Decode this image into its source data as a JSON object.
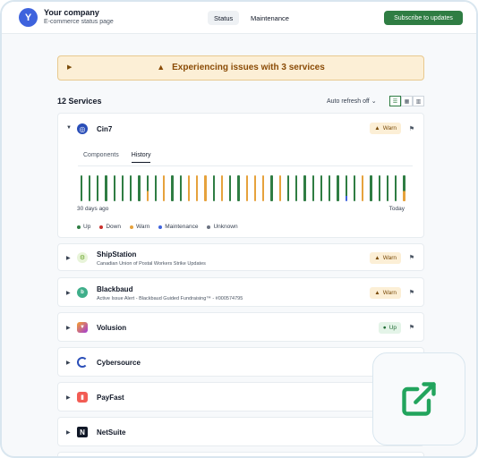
{
  "company": {
    "avatar": "Y",
    "name": "Your company",
    "subtitle": "E-commerce status page"
  },
  "nav": {
    "status": "Status",
    "maintenance": "Maintenance",
    "subscribe": "Subscribe to updates"
  },
  "alert": {
    "text": "Experiencing issues with 3 services"
  },
  "services_header": {
    "count": "12 Services",
    "auto_refresh": "Auto refresh off"
  },
  "services": [
    {
      "name": "Cin7",
      "status": "Warn",
      "expanded": true
    },
    {
      "name": "ShipStation",
      "description": "Canadian Union of Postal Workers Strike Updates",
      "status": "Warn"
    },
    {
      "name": "Blackbaud",
      "description": "Active Issue Alert - Blackbaud Guided Fundraising™ - #000574795",
      "status": "Warn"
    },
    {
      "name": "Volusion",
      "status": "Up"
    },
    {
      "name": "Cybersource"
    },
    {
      "name": "PayFast"
    },
    {
      "name": "NetSuite"
    }
  ],
  "detail": {
    "tabs": [
      "Components",
      "History"
    ],
    "active_tab": "History",
    "range_start": "30 days ago",
    "range_end": "Today",
    "history": [
      "up",
      "up",
      "up",
      "up",
      "up",
      "up",
      "up",
      "up",
      "warn",
      "up",
      "warn",
      "up",
      "up",
      "warn",
      "warn",
      "warn",
      "up",
      "warn",
      "up",
      "up",
      "warn",
      "warn",
      "warn",
      "up",
      "warn",
      "up",
      "up",
      "up",
      "up",
      "up",
      "up",
      "up",
      "maintenance",
      "up",
      "warn",
      "up",
      "up",
      "up",
      "up",
      "warn"
    ],
    "legend": [
      {
        "label": "Up",
        "color": "#2f7d43"
      },
      {
        "label": "Down",
        "color": "#c9302c"
      },
      {
        "label": "Warn",
        "color": "#e6a23c"
      },
      {
        "label": "Maintenance",
        "color": "#3e63dd"
      },
      {
        "label": "Unknown",
        "color": "#6b7280"
      }
    ]
  },
  "colors": {
    "accent": "#2f7d43",
    "warn": "#e6a23c",
    "up": "#2f7d43",
    "maintenance": "#3e63dd",
    "down": "#c9302c"
  },
  "icons": {
    "overlay": "open-external-icon"
  }
}
